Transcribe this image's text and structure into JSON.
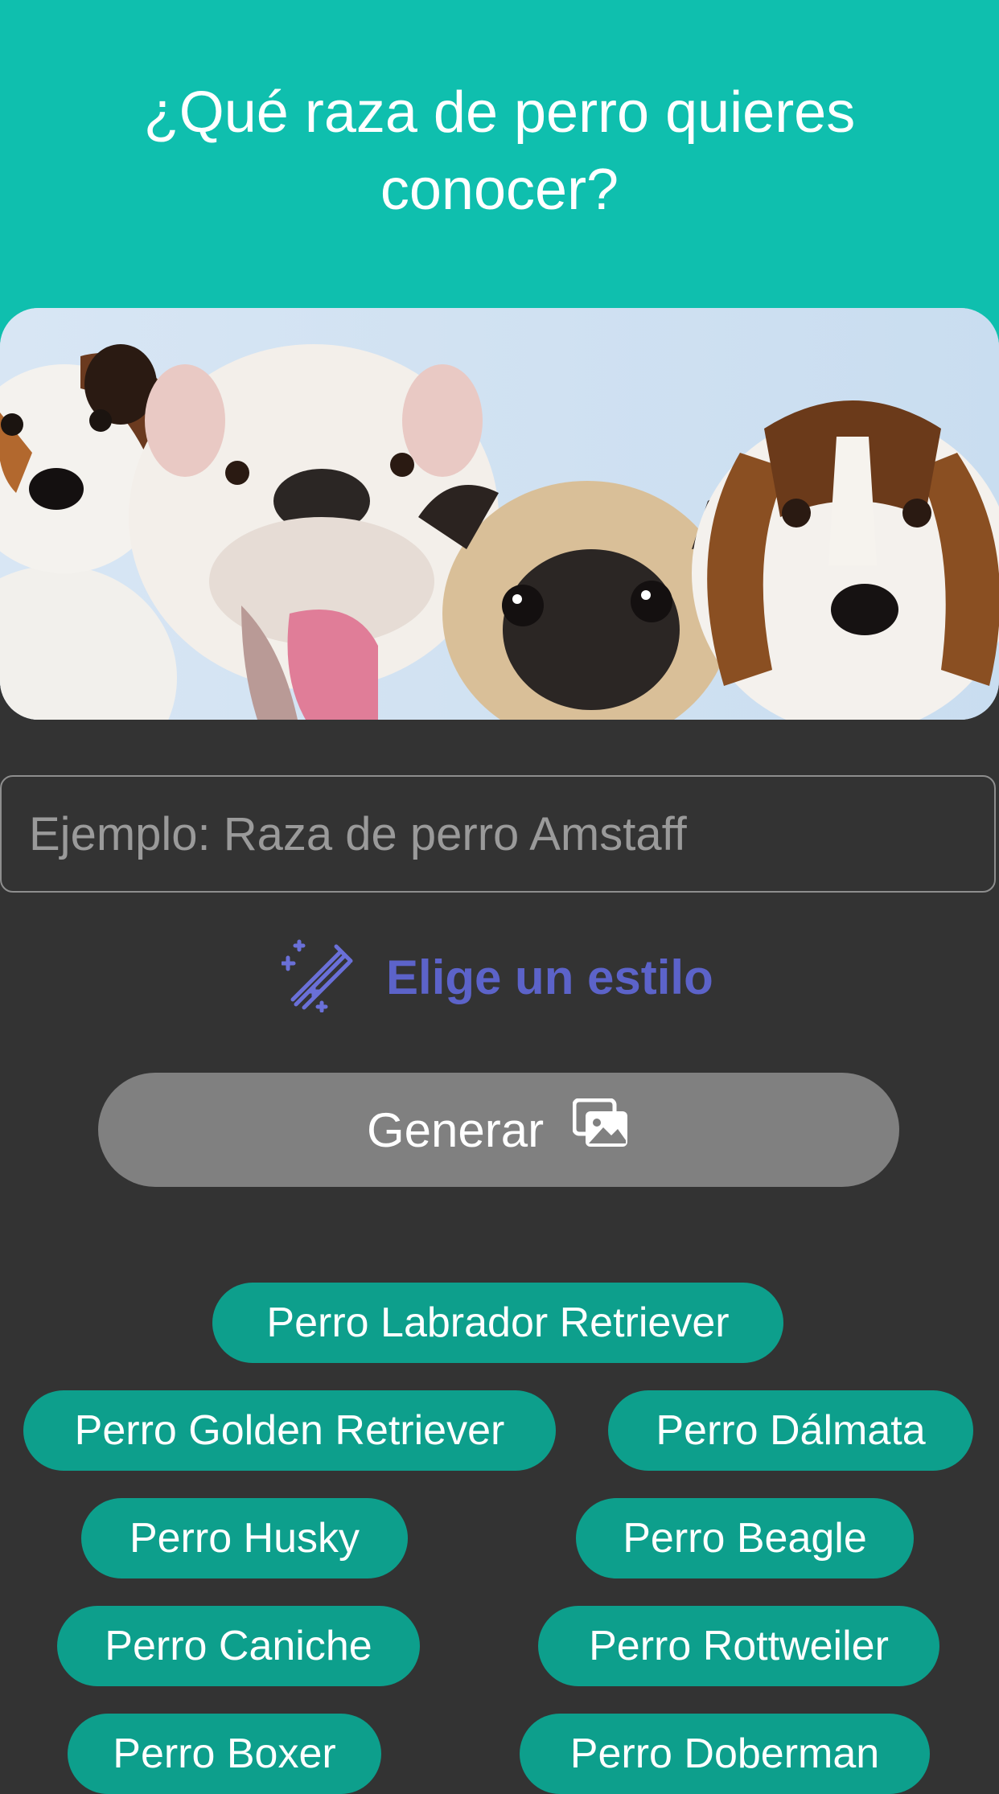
{
  "header": {
    "title": "¿Qué raza de perro quieres conocer?"
  },
  "hero": {
    "image_description_icon": "dog-breeds-photo"
  },
  "search": {
    "placeholder": "Ejemplo: Raza de perro Amstaff",
    "value": ""
  },
  "style_picker": {
    "label": "Elige un estilo",
    "icon": "magic-wand-icon"
  },
  "generate": {
    "label": "Generar",
    "icon": "images-icon"
  },
  "suggestions": [
    "Perro Labrador Retriever",
    "Perro Golden Retriever",
    "Perro Dálmata",
    "Perro Husky",
    "Perro Beagle",
    "Perro Caniche",
    "Perro Rottweiler",
    "Perro Boxer",
    "Perro Doberman"
  ],
  "colors": {
    "header_bg": "#0fbfae",
    "page_bg": "#333333",
    "accent_purple": "#5c63c9",
    "chip_bg": "#0d9f8c",
    "button_bg": "#808080"
  }
}
